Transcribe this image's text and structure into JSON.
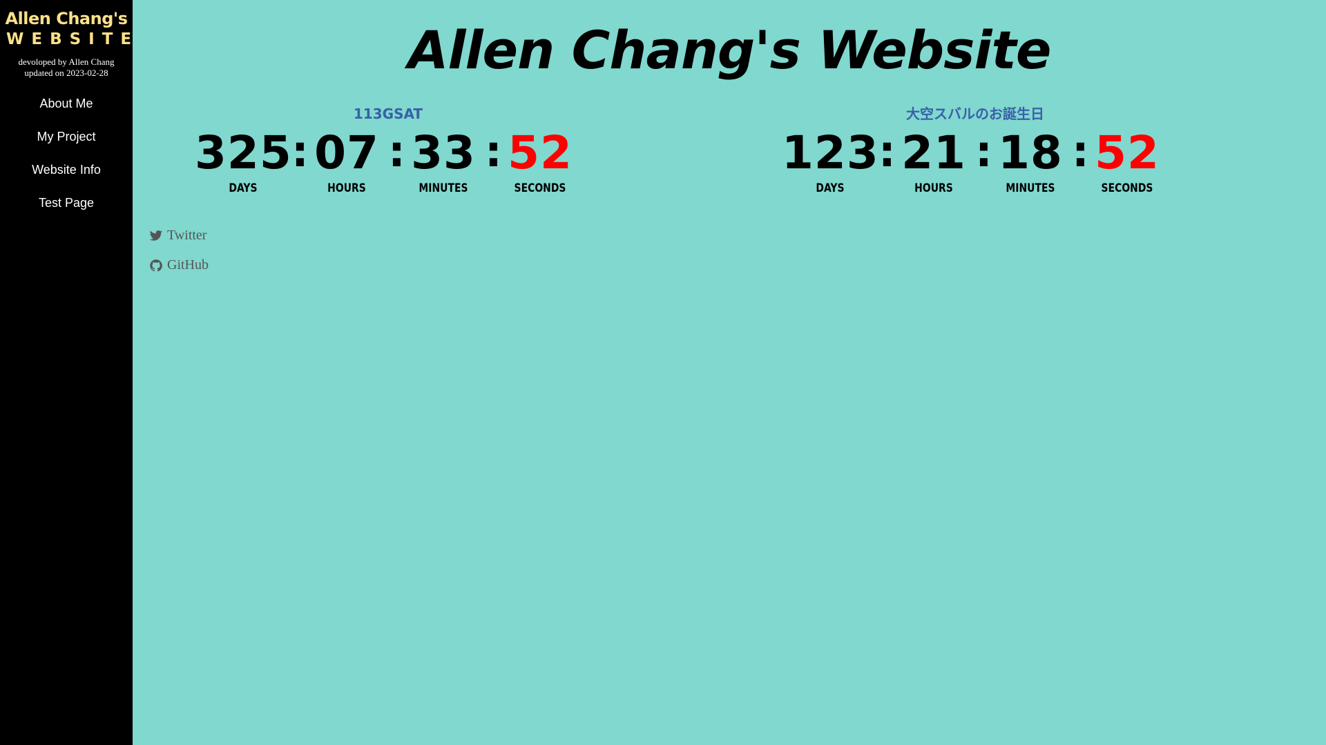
{
  "sidebar": {
    "logo_line1": "Allen Chang's",
    "logo_line2": "WEBSITE",
    "developed_by": "devoloped by Allen Chang",
    "updated_on": "updated on 2023-02-28",
    "nav": [
      {
        "label": "About Me"
      },
      {
        "label": "My Project"
      },
      {
        "label": "Website Info"
      },
      {
        "label": "Test Page"
      }
    ]
  },
  "main": {
    "title": "Allen Chang's Website"
  },
  "countdowns": [
    {
      "title": "113GSAT",
      "days": "325",
      "hours": "07",
      "minutes": "33",
      "seconds": "52",
      "separator": ":",
      "labels": {
        "days": "DAYS",
        "hours": "HOURS",
        "minutes": "MINUTES",
        "seconds": "SECONDS"
      }
    },
    {
      "title": "大空スバルのお誕生日",
      "days": "123",
      "hours": "21",
      "minutes": "18",
      "seconds": "52",
      "separator": ":",
      "labels": {
        "days": "DAYS",
        "hours": "HOURS",
        "minutes": "MINUTES",
        "seconds": "SECONDS"
      }
    }
  ],
  "social": [
    {
      "label": "Twitter",
      "icon": "twitter-icon"
    },
    {
      "label": "GitHub",
      "icon": "github-icon"
    }
  ],
  "colors": {
    "background": "#80d8cf",
    "sidebar": "#000000",
    "logo": "#fde189",
    "countdown_title": "#3a5fa8",
    "seconds": "#ff0000",
    "social_text": "#555555"
  }
}
